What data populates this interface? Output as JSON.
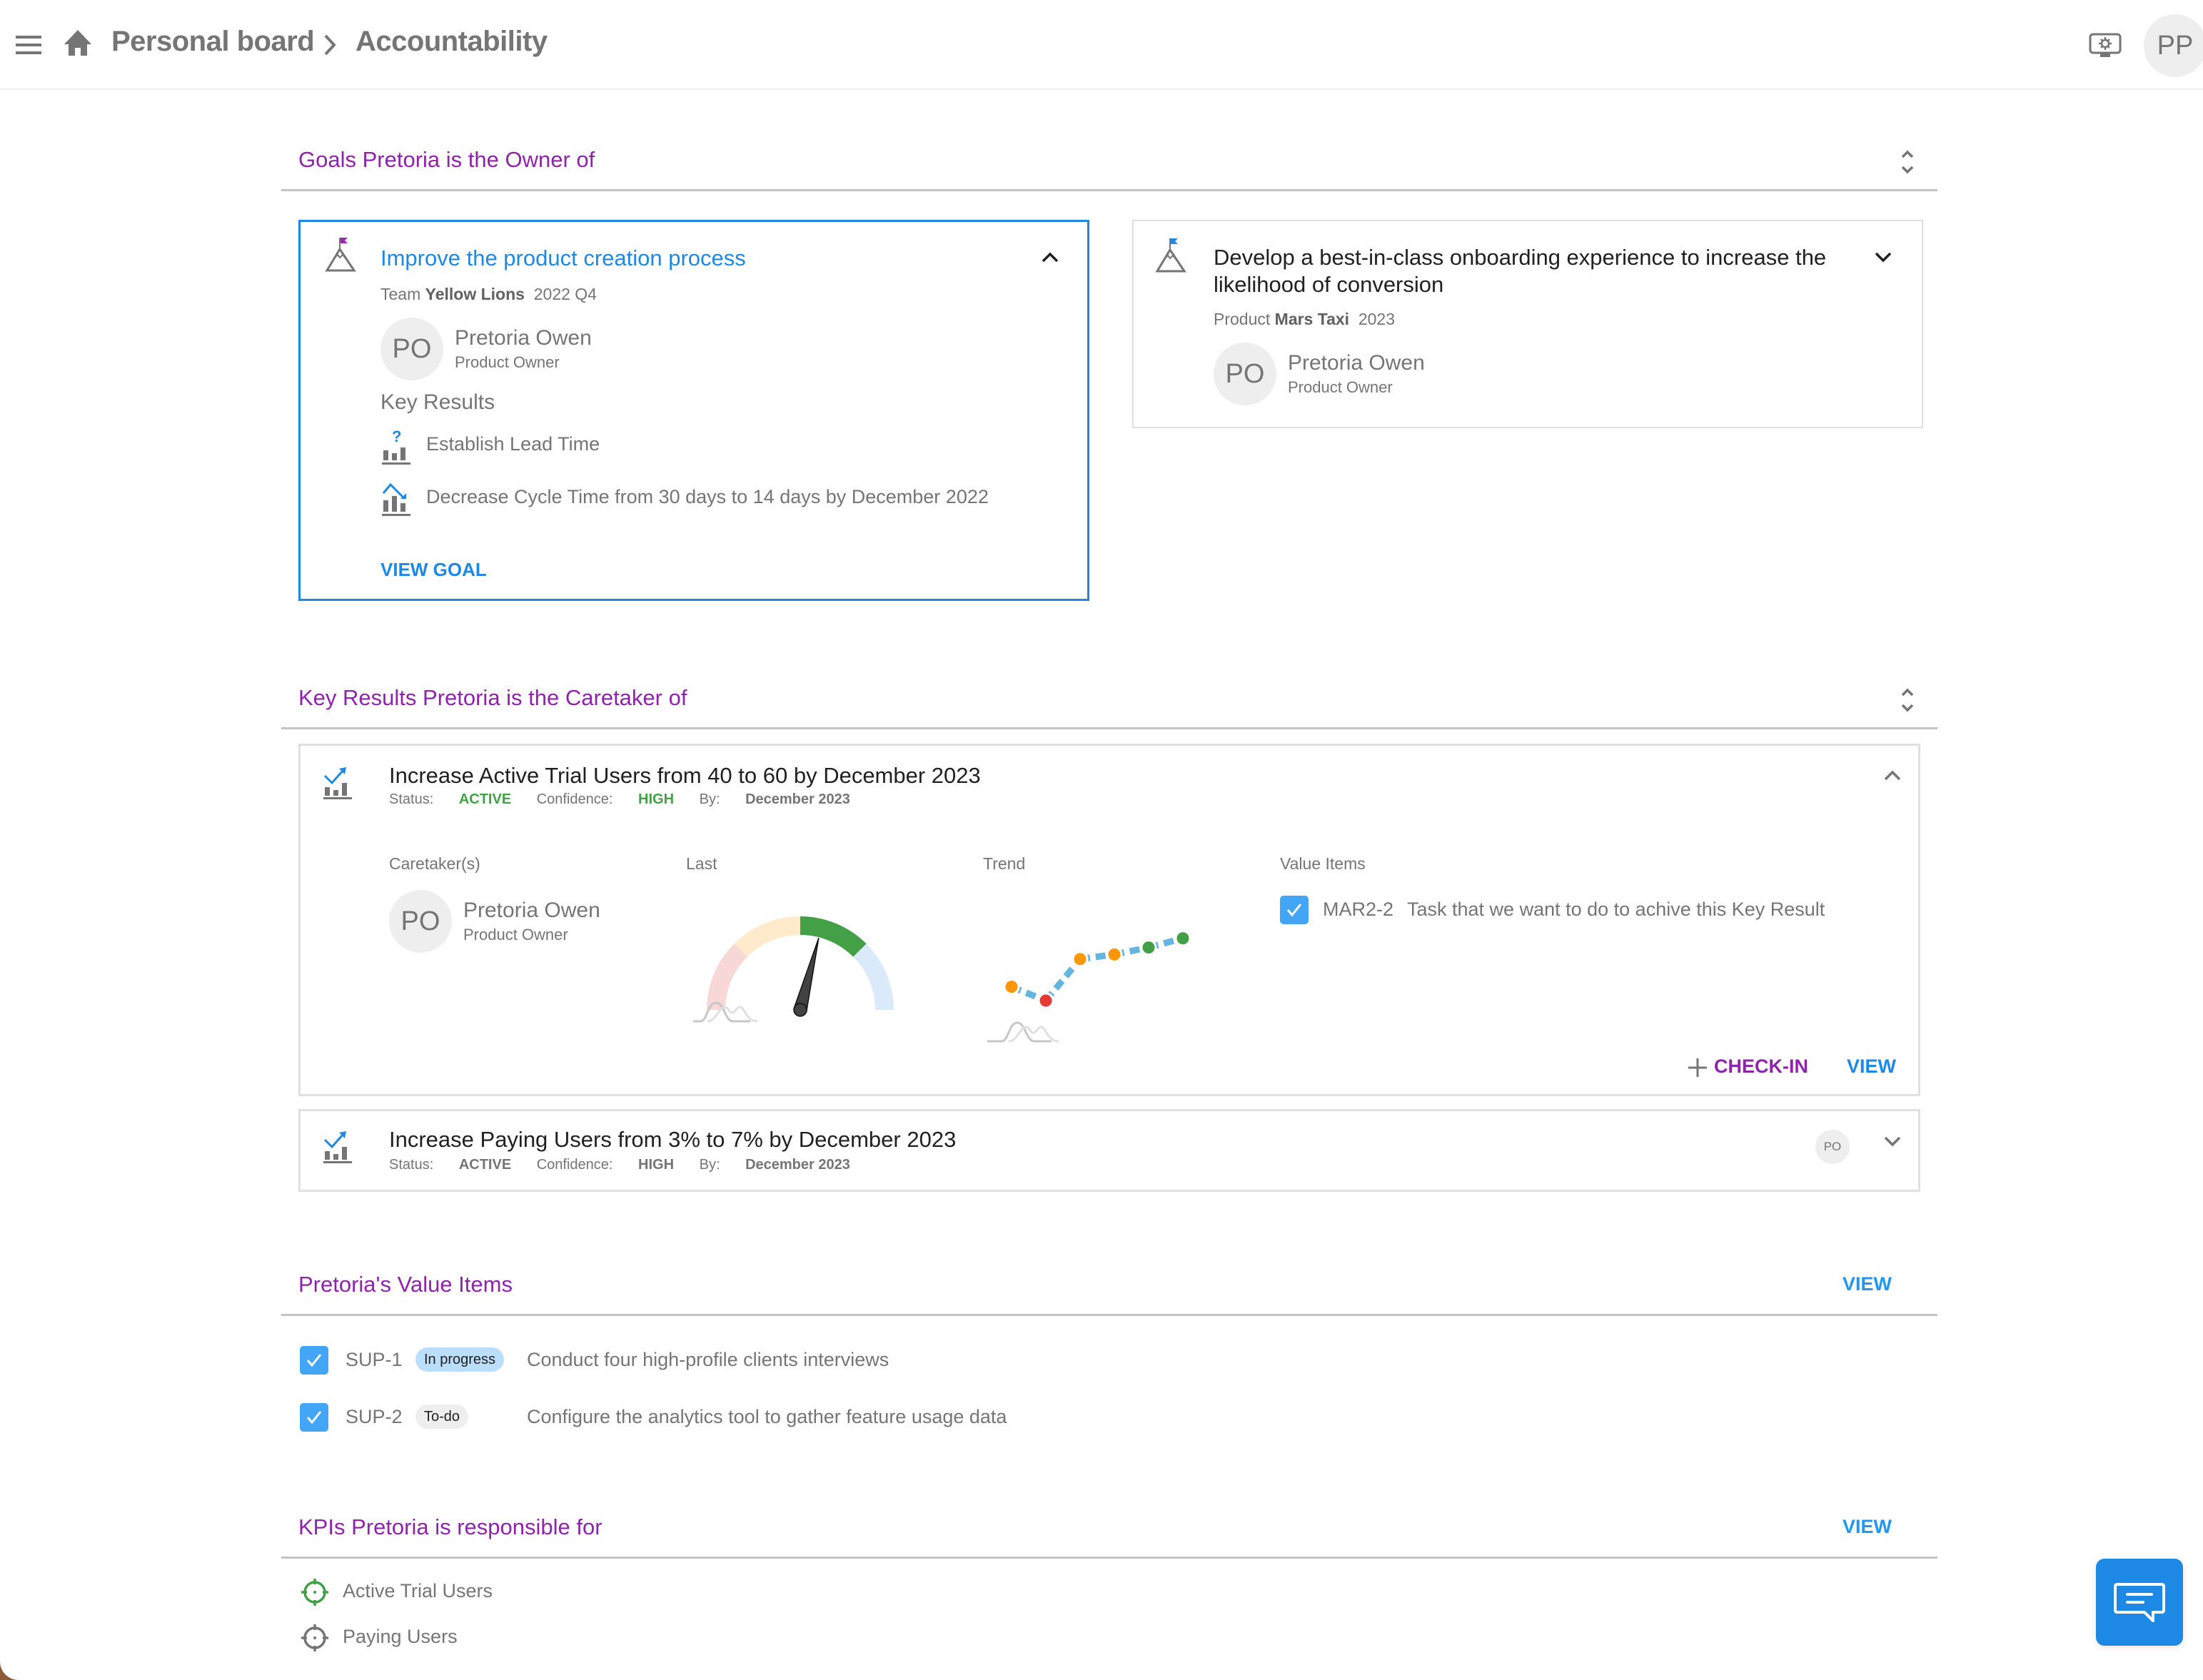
{
  "topbar": {
    "menu_icon": "hamburger-menu-icon",
    "home_icon": "home-icon",
    "breadcrumb": [
      "Personal board",
      "Accountability"
    ],
    "settings_icon": "monitor-settings-icon",
    "user_initials": "PP"
  },
  "goals_section": {
    "title": "Goals Pretoria is the Owner of",
    "goals": [
      {
        "title": "Improve the product creation process",
        "scope_label": "Team",
        "scope_name": "Yellow Lions",
        "period": "2022 Q4",
        "flag_color": "#9c27b0",
        "expanded": true,
        "owner": {
          "initials": "PO",
          "name": "Pretoria Owen",
          "role": "Product Owner"
        },
        "key_results_heading": "Key Results",
        "key_results": [
          {
            "icon": "kr-unknown-icon",
            "text": "Establish Lead Time"
          },
          {
            "icon": "kr-decrease-icon",
            "text": "Decrease Cycle Time from 30 days to 14 days by December 2022"
          }
        ],
        "view_label": "VIEW GOAL"
      },
      {
        "title": "Develop a best-in-class onboarding experience to increase the likelihood of conversion",
        "scope_label": "Product",
        "scope_name": "Mars Taxi",
        "period": "2023",
        "flag_color": "#1e88e5",
        "expanded": false,
        "owner": {
          "initials": "PO",
          "name": "Pretoria Owen",
          "role": "Product Owner"
        }
      }
    ]
  },
  "kr_section": {
    "title": "Key Results Pretoria is the Caretaker of",
    "items": [
      {
        "title": "Increase Active Trial Users from 40 to 60 by December 2023",
        "status_label": "Status:",
        "status": "ACTIVE",
        "confidence_label": "Confidence:",
        "confidence": "HIGH",
        "by_label": "By:",
        "by": "December 2023",
        "expanded": true,
        "caretakers_label": "Caretaker(s)",
        "caretaker": {
          "initials": "PO",
          "name": "Pretoria Owen",
          "role": "Product Owner"
        },
        "last_label": "Last",
        "gauge": {
          "zones": [
            "#f8d7d7",
            "#ffebcc",
            "#43a047",
            "#dbeafb"
          ],
          "needle_fraction": 0.58
        },
        "trend_label": "Trend",
        "trend": {
          "values": [
            40,
            37,
            46,
            47,
            48.5,
            50.5
          ],
          "colors": [
            "#ff9800",
            "#e53935",
            "#ff9800",
            "#ff9800",
            "#43a047",
            "#43a047"
          ],
          "line_color": "#64b5e0"
        },
        "value_items_label": "Value Items",
        "value_items": [
          {
            "key": "MAR2-2",
            "text": "Task that we want to do to achive this Key Result",
            "checked": true
          }
        ],
        "checkin_label": "CHECK-IN",
        "view_label": "VIEW"
      },
      {
        "title": "Increase Paying Users from 3% to 7% by December 2023",
        "status_label": "Status:",
        "status": "ACTIVE",
        "confidence_label": "Confidence:",
        "confidence": "HIGH",
        "by_label": "By:",
        "by": "December 2023",
        "expanded": false,
        "caretaker_initials": "PO"
      }
    ]
  },
  "value_items_section": {
    "title": "Pretoria's Value Items",
    "view_label": "VIEW",
    "items": [
      {
        "key": "SUP-1",
        "status": "In progress",
        "text": "Conduct four high-profile clients interviews",
        "checked": true
      },
      {
        "key": "SUP-2",
        "status": "To-do",
        "text": "Configure the analytics tool to gather feature usage data",
        "checked": true
      }
    ]
  },
  "kpi_section": {
    "title": "KPIs Pretoria is responsible for",
    "view_label": "VIEW",
    "items": [
      {
        "name": "Active Trial Users",
        "icon_color": "#43a047"
      },
      {
        "name": "Paying Users",
        "icon_color": "#757575"
      }
    ]
  },
  "chat": {
    "icon": "chat-icon"
  },
  "colors": {
    "accent_purple": "#8e24aa",
    "accent_blue": "#1e88e5",
    "success_green": "#43a047"
  }
}
